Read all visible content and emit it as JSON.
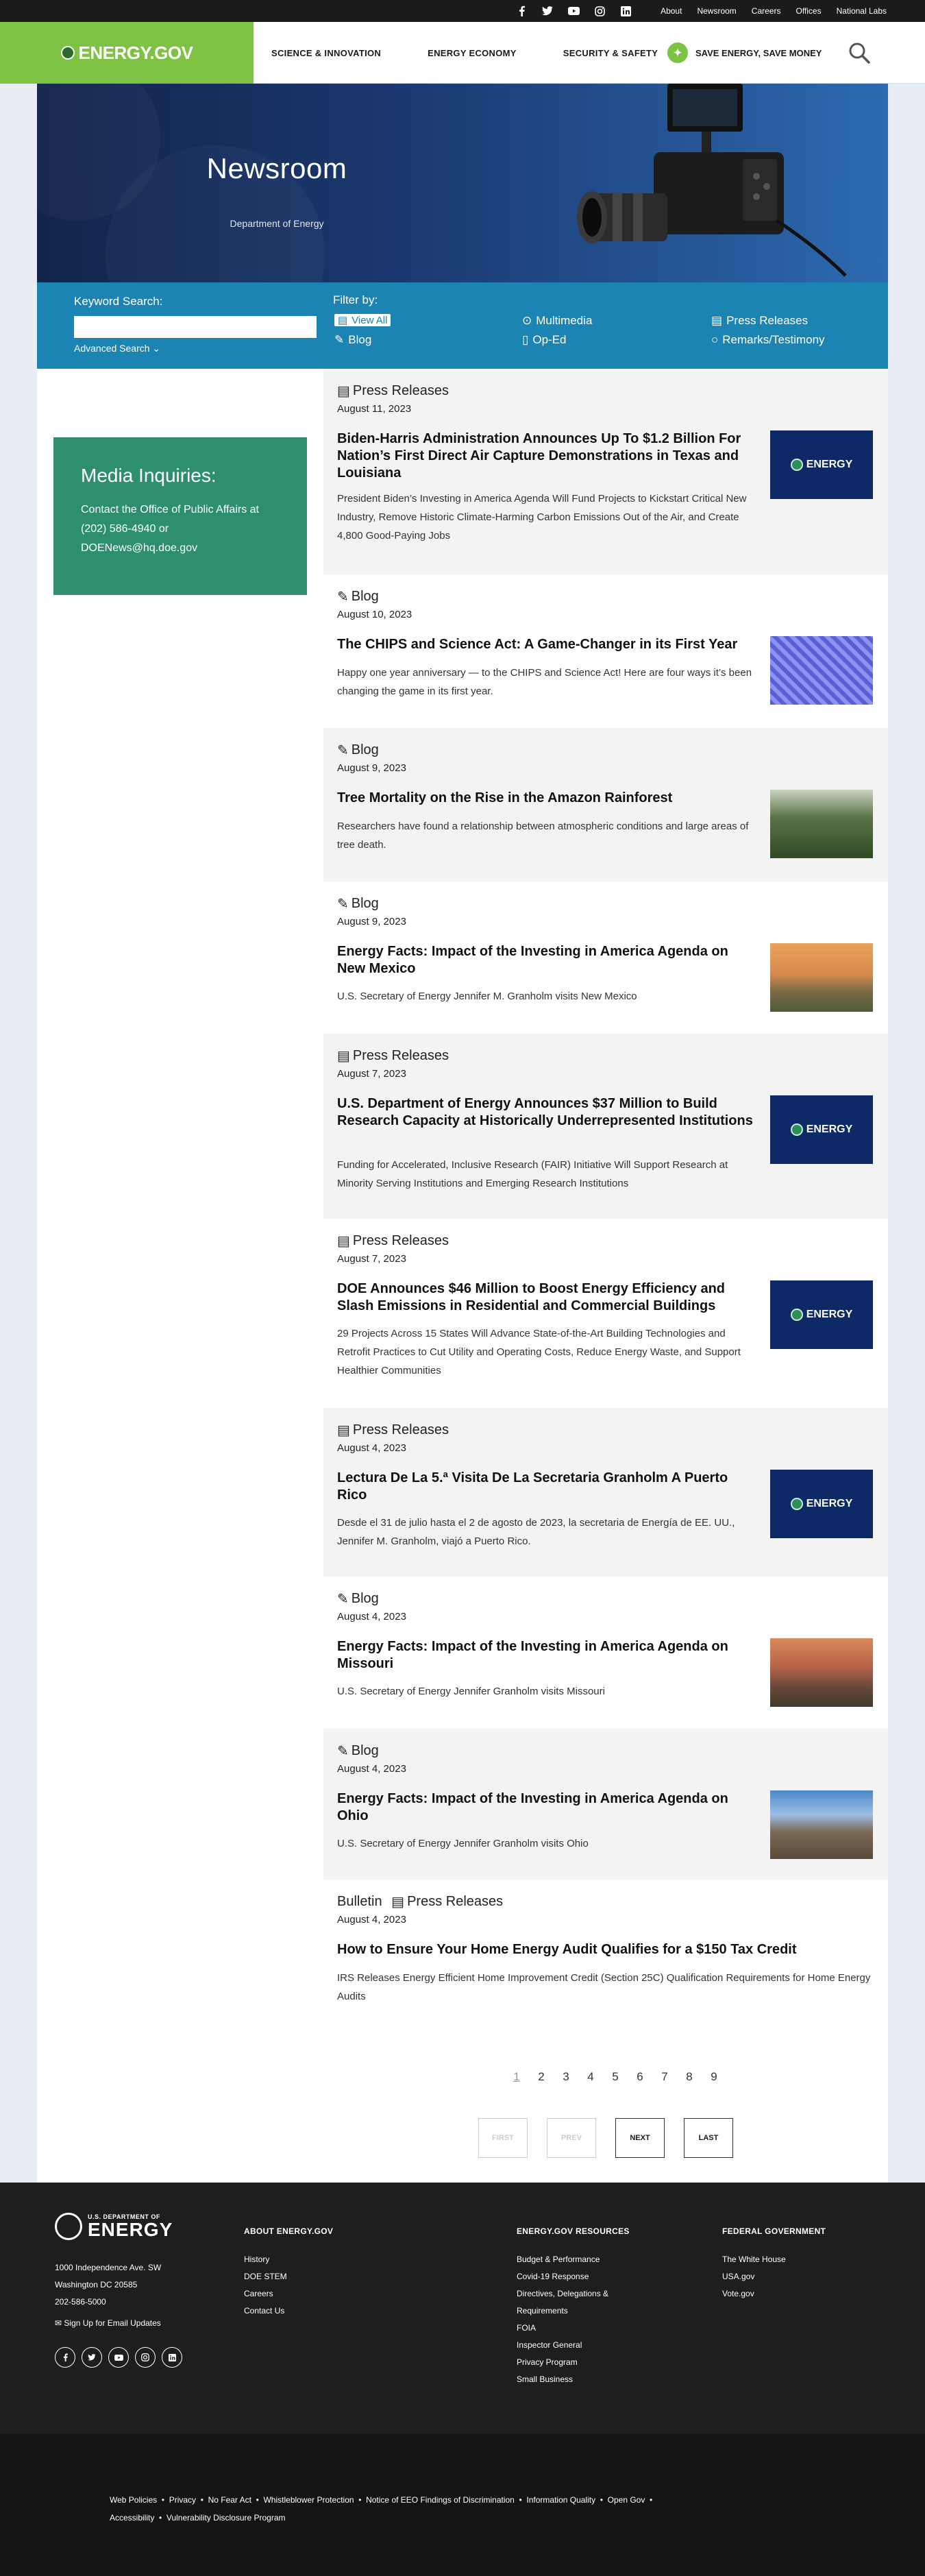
{
  "util_bar": {
    "social": [
      "facebook-icon",
      "twitter-icon",
      "youtube-icon",
      "instagram-icon",
      "linkedin-icon"
    ],
    "links": [
      "About",
      "Newsroom",
      "Careers",
      "Offices",
      "National Labs"
    ]
  },
  "header": {
    "logo": "ENERGY.GOV",
    "nav": [
      "SCIENCE & INNOVATION",
      "ENERGY ECONOMY",
      "SECURITY & SAFETY"
    ],
    "save": "SAVE ENERGY, SAVE MONEY"
  },
  "hero": {
    "title": "Newsroom",
    "subtitle": "Department of Energy"
  },
  "filter": {
    "keyword_label": "Keyword Search:",
    "advanced": "Advanced Search",
    "filter_label": "Filter by:",
    "options": [
      "View All",
      "Multimedia",
      "Press Releases",
      "Blog",
      "Op-Ed",
      "Remarks/Testimony"
    ]
  },
  "media": {
    "title": "Media Inquiries:",
    "text": "Contact the Office of Public Affairs at (202) 586-4940 or DOENews@hq.doe.gov"
  },
  "articles": [
    {
      "type": "Press Releases",
      "date": "August 11, 2023",
      "title": "Biden-Harris Administration Announces Up To $1.2 Billion For Nation’s First Direct Air Capture Demonstrations in Texas and Louisiana",
      "desc": "President Biden’s Investing in America Agenda Will Fund Projects to Kickstart Critical New Industry, Remove Historic Climate-Harming Carbon Emissions Out of the Air, and Create 4,800 Good-Paying Jobs",
      "thumb": "ENERGY"
    },
    {
      "type": "Blog",
      "date": "August 10, 2023",
      "title": "The CHIPS and Science Act: A Game-Changer in its First Year",
      "desc": "Happy one year anniversary — to the CHIPS and Science Act! Here are four ways it’s been changing the game in its first year.",
      "thumb": ""
    },
    {
      "type": "Blog",
      "date": "August 9, 2023",
      "title": "Tree Mortality on the Rise in the Amazon Rainforest",
      "desc": "Researchers have found a relationship between atmospheric conditions and large areas of tree death.",
      "thumb": ""
    },
    {
      "type": "Blog",
      "date": "August 9, 2023",
      "title": "Energy Facts: Impact of the Investing in America Agenda on New Mexico",
      "desc": "U.S. Secretary of Energy Jennifer M. Granholm visits New Mexico",
      "thumb": ""
    },
    {
      "type": "Press Releases",
      "date": "August 7, 2023",
      "title": "U.S. Department of Energy Announces $37 Million to Build Research Capacity at Historically Underrepresented Institutions",
      "desc": "Funding for Accelerated, Inclusive Research (FAIR) Initiative Will Support Research at Minority Serving Institutions and Emerging Research Institutions",
      "thumb": "ENERGY"
    },
    {
      "type": "Press Releases",
      "date": "August 7, 2023",
      "title": "DOE Announces $46 Million to Boost Energy Efficiency and Slash Emissions in Residential and Commercial Buildings",
      "desc": "29 Projects Across 15 States Will Advance State-of-the-Art Building Technologies and Retrofit Practices to Cut Utility and Operating Costs, Reduce Energy Waste, and Support Healthier Communities",
      "thumb": "ENERGY"
    },
    {
      "type": "Press Releases",
      "date": "August 4, 2023",
      "title": "Lectura De La 5.ª Visita De La Secretaria Granholm A Puerto Rico",
      "desc": "Desde el 31 de julio hasta el 2 de agosto de 2023, la secretaria de Energía de EE. UU., Jennifer M. Granholm, viajó a Puerto Rico.",
      "thumb": "ENERGY"
    },
    {
      "type": "Blog",
      "date": "August 4, 2023",
      "title": "Energy Facts: Impact of the Investing in America Agenda on Missouri",
      "desc": "U.S. Secretary of Energy Jennifer Granholm visits Missouri",
      "thumb": ""
    },
    {
      "type": "Blog",
      "date": "August 4, 2023",
      "title": "Energy Facts: Impact of the Investing in America Agenda on Ohio",
      "desc": "U.S. Secretary of Energy Jennifer Granholm visits Ohio",
      "thumb": ""
    },
    {
      "type_prefix": "Bulletin",
      "type": "Press Releases",
      "date": "August 4, 2023",
      "title": "How to Ensure Your Home Energy Audit Qualifies for a $150 Tax Credit",
      "desc": "IRS Releases Energy Efficient Home Improvement Credit (Section 25C) Qualification Requirements for Home Energy Audits",
      "thumb": ""
    }
  ],
  "pagination": {
    "pages": [
      "1",
      "2",
      "3",
      "4",
      "5",
      "6",
      "7",
      "8",
      "9"
    ],
    "first": "FIRST",
    "prev": "PREV",
    "next": "NEXT",
    "last": "LAST"
  },
  "footer": {
    "logo_small": "U.S. DEPARTMENT OF",
    "logo_big": "ENERGY",
    "address": [
      "1000 Independence Ave. SW",
      "Washington DC 20585",
      "202-586-5000"
    ],
    "signup": "Sign Up for Email Updates",
    "columns": [
      {
        "title": "ABOUT ENERGY.GOV",
        "items": [
          "History",
          "DOE STEM",
          "Careers",
          "Contact Us"
        ]
      },
      {
        "title": "ENERGY.GOV RESOURCES",
        "items": [
          "Budget & Performance",
          "Covid-19 Response",
          "Directives, Delegations & Requirements",
          "FOIA",
          "Inspector General",
          "Privacy Program",
          "Small Business"
        ]
      },
      {
        "title": "FEDERAL GOVERNMENT",
        "items": [
          "The White House",
          "USA.gov",
          "Vote.gov"
        ]
      }
    ],
    "bottom_links": [
      "Web Policies",
      "Privacy",
      "No Fear Act",
      "Whistleblower Protection",
      "Notice of EEO Findings of Discrimination",
      "Information Quality",
      "Open Gov",
      "Accessibility",
      "Vulnerability Disclosure Program"
    ]
  },
  "colors": {
    "green": "#7dc243",
    "blue": "#1b84b3",
    "media_green": "#2e8f6f",
    "navy": "#0d2a66"
  }
}
